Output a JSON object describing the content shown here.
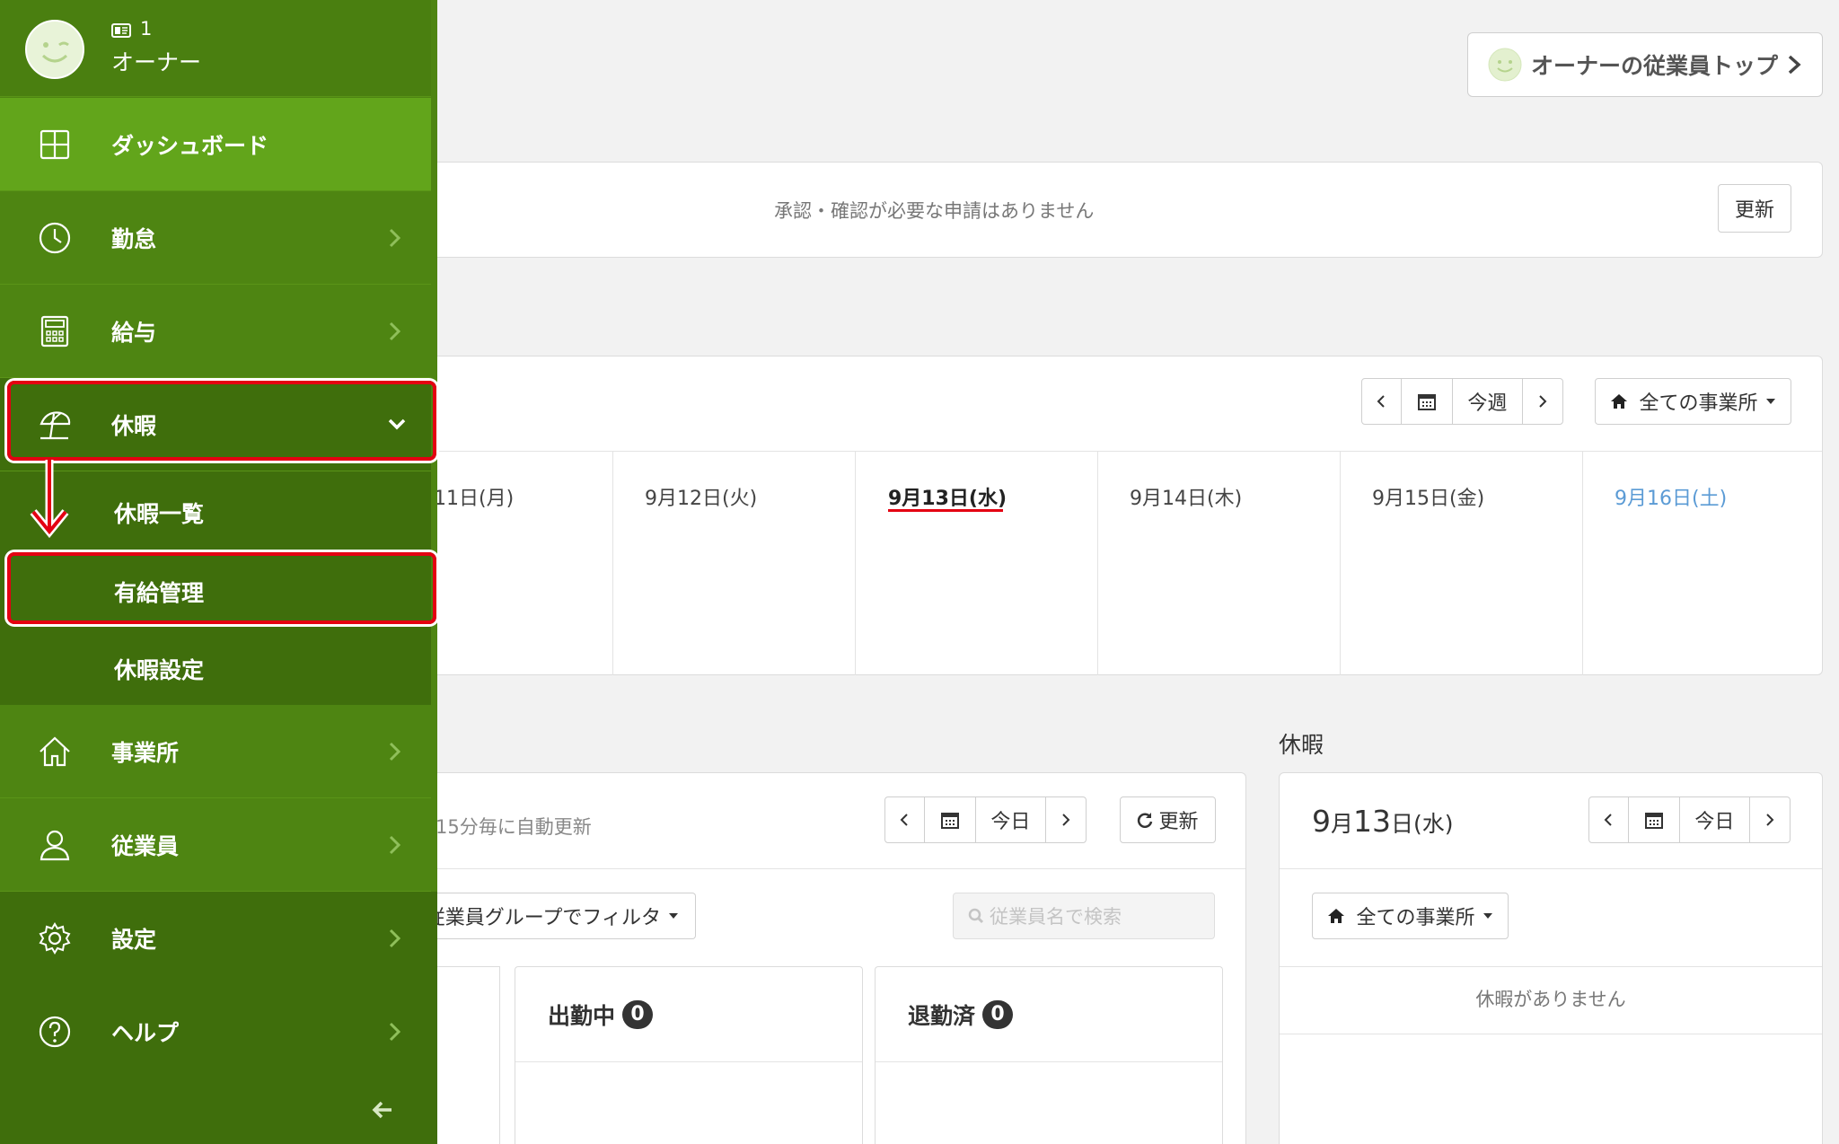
{
  "user": {
    "id_number": "1",
    "name": "オーナー"
  },
  "sidebar": {
    "items": [
      {
        "label": "ダッシュボード",
        "icon": "dashboard-icon"
      },
      {
        "label": "勤怠",
        "icon": "clock-icon"
      },
      {
        "label": "給与",
        "icon": "calculator-icon"
      },
      {
        "label": "休暇",
        "icon": "umbrella-icon"
      },
      {
        "label": "事業所",
        "icon": "home-icon"
      },
      {
        "label": "従業員",
        "icon": "person-icon"
      },
      {
        "label": "設定",
        "icon": "gear-icon"
      },
      {
        "label": "ヘルプ",
        "icon": "help-icon"
      }
    ],
    "leave_submenu": [
      "休暇一覧",
      "有給管理",
      "休暇設定"
    ],
    "collapse_icon": "arrow-left-icon"
  },
  "header": {
    "employee_top_button": "オーナーの従業員トップ"
  },
  "approvals": {
    "message": "承認・確認が必要な申請はありません",
    "refresh_label": "更新"
  },
  "week": {
    "this_week_label": "今週",
    "office_filter": "全ての事業所",
    "days": [
      "11日(月)",
      "9月12日(火)",
      "9月13日(水)",
      "9月14日(木)",
      "9月15日(金)",
      "9月16日(土)"
    ]
  },
  "attendance": {
    "auto_refresh_note": "15分毎に自動更新",
    "today_label": "今日",
    "refresh_label": "更新",
    "group_filter": "従業員グループでフィルタ",
    "search_placeholder": "従業員名で検索",
    "columns": [
      {
        "label": "出勤中",
        "count": "0"
      },
      {
        "label": "退勤済",
        "count": "0"
      }
    ]
  },
  "leave_panel": {
    "section_title": "休暇",
    "date_month": "9",
    "date_month_suffix": "月",
    "date_day": "13",
    "date_day_suffix": "日(水)",
    "today_label": "今日",
    "office_filter": "全ての事業所",
    "empty_message": "休暇がありません"
  },
  "colors": {
    "sidebar_green": "#4e8512",
    "active_green": "#62a51b",
    "highlight_red": "#e40012",
    "today_underline": "#e40012",
    "saturday_blue": "#5b9bd5",
    "badge_dark": "#333333"
  }
}
